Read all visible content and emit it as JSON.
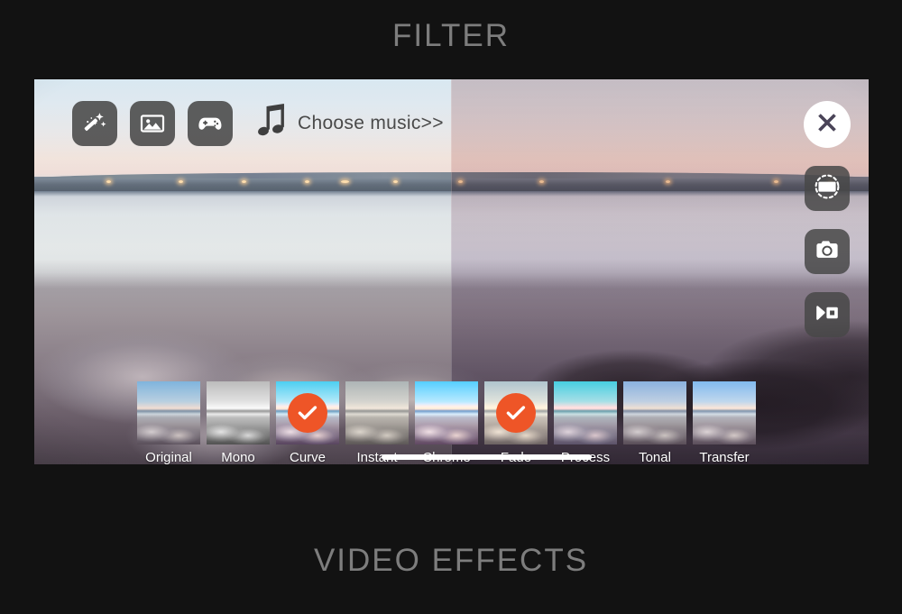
{
  "page": {
    "title": "FILTER",
    "footer": "VIDEO EFFECTS",
    "title_color": "#7d7d7d",
    "background": "#121212"
  },
  "toolbar": {
    "buttons": [
      {
        "name": "magic-wand-icon",
        "label": "Magic Effects"
      },
      {
        "name": "photo-icon",
        "label": "Photos"
      },
      {
        "name": "gamepad-icon",
        "label": "Games"
      }
    ],
    "music": {
      "icon": "music-note-icon",
      "label": "Choose music>>",
      "color": "#4a4a4a"
    }
  },
  "right_rail": {
    "close": {
      "icon": "close-icon",
      "label": "Close"
    },
    "buttons": [
      {
        "name": "rotate-frame-icon",
        "label": "Aspect Ratio"
      },
      {
        "name": "camera-icon",
        "label": "Photo Capture"
      },
      {
        "name": "video-camera-icon",
        "label": "Video Capture"
      }
    ]
  },
  "preview": {
    "split_label": "Filter preview split",
    "selected_accent": "#ee5527"
  },
  "filters": {
    "selected_accent": "#ee5527",
    "check_icon": "check-icon",
    "items": [
      {
        "label": "Original",
        "look": "look-base",
        "selected": false
      },
      {
        "label": "Mono",
        "look": "look-base look-mono",
        "selected": false
      },
      {
        "label": "Curve",
        "look": "look-base look-curve",
        "selected": true
      },
      {
        "label": "Instant",
        "look": "look-base look-instant",
        "selected": false
      },
      {
        "label": "Chrome",
        "look": "look-base look-chrome",
        "selected": false
      },
      {
        "label": "Fade",
        "look": "look-base look-fade",
        "selected": true
      },
      {
        "label": "Process",
        "look": "look-base look-process",
        "selected": false
      },
      {
        "label": "Tonal",
        "look": "look-base look-tonal",
        "selected": false
      },
      {
        "label": "Transfer",
        "look": "look-base look-transfer",
        "selected": false
      }
    ],
    "scrollbar": {
      "name": "filter-scrollbar"
    }
  }
}
